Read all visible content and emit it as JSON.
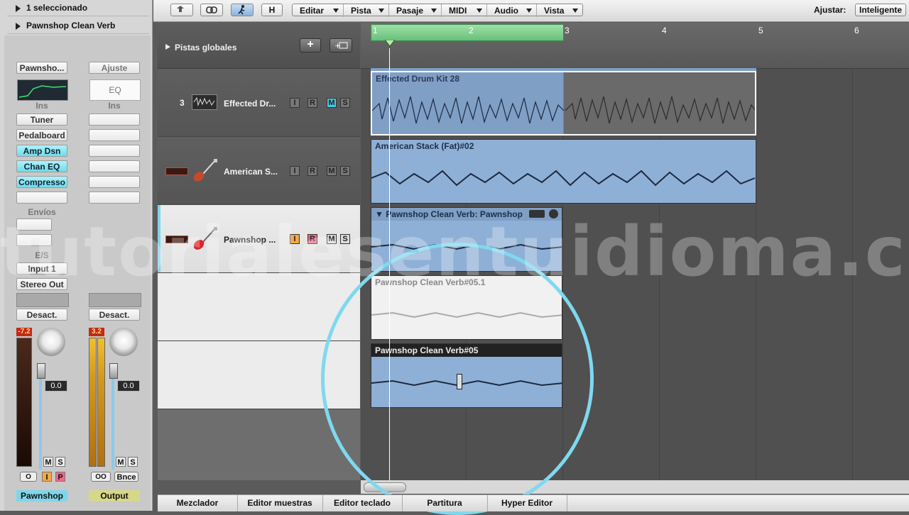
{
  "inspector": {
    "selection_label": "1 seleccionado",
    "region_name": "Pawnshop Clean Verb",
    "channel_left": {
      "setting_button": "Pawnsho...",
      "ins_label": "Ins",
      "plugins": [
        "Tuner",
        "Pedalboard",
        "Amp Dsn",
        "Chan EQ",
        "Compresso",
        ""
      ],
      "sends_label": "Envíos",
      "io_label": "E/S",
      "input": "Input 1",
      "output": "Stereo Out",
      "automation": "Desact.",
      "peak": "-7.2",
      "volume": "0.0",
      "m": "M",
      "s": "S",
      "i": "I",
      "p": "P",
      "name": "Pawnshop"
    },
    "channel_right": {
      "setting_button": "Ajuste",
      "eq_label": "EQ",
      "ins_label": "Ins",
      "automation": "Desact.",
      "peak": "3.2",
      "volume": "0.0",
      "m": "M",
      "s": "S",
      "bnce": "Bnce",
      "name": "Output"
    }
  },
  "toolbar": {
    "h_button": "H",
    "menus": [
      "Editar",
      "Pista",
      "Pasaje",
      "MIDI",
      "Audio",
      "Vista"
    ],
    "snap_label": "Ajustar:",
    "snap_value": "Inteligente"
  },
  "global_tracks_label": "Pistas globales",
  "ruler": [
    "1",
    "2",
    "3",
    "4",
    "5",
    "6"
  ],
  "tracks": [
    {
      "number": "3",
      "name": "Effected Dr..."
    },
    {
      "number": "",
      "name": "American S..."
    },
    {
      "number": "",
      "name": "Pawnshop ..."
    }
  ],
  "track_buttons": {
    "i": "I",
    "r": "R",
    "m": "M",
    "s": "S"
  },
  "regions": {
    "drum": "Effected Drum Kit 28",
    "american": "American Stack (Fat)#02",
    "pawnshop_folder": "Pawnshop Clean Verb: Pawnshop",
    "take1": "Pawnshop Clean Verb#05.1",
    "take2": "Pawnshop Clean Verb#05"
  },
  "bottom_tabs": [
    "Mezclador",
    "Editor muestras",
    "Editor teclado",
    "Partitura",
    "Hyper Editor"
  ],
  "watermark": "tutorialesentuidioma.com",
  "colors": {
    "accent_cyan": "#6fdcea",
    "cycle_green": "#7fcf8f",
    "region_blue": "#8fb0d6",
    "circle_highlight": "#7fd8f0"
  }
}
